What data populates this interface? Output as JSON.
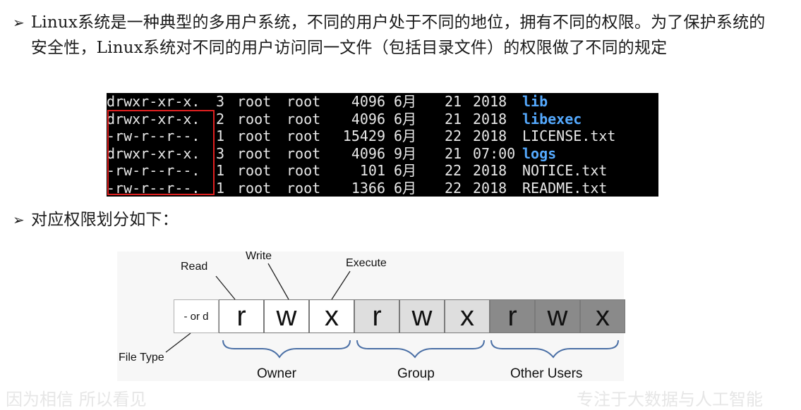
{
  "bullets": [
    {
      "marker": "➢",
      "text": "Linux系统是一种典型的多用户系统，不同的用户处于不同的地位，拥有不同的权限。为了保护系统的安全性，Linux系统对不同的用户访问同一文件（包括目录文件）的权限做了不同的规定"
    },
    {
      "marker": "➢",
      "text": "对应权限划分如下："
    }
  ],
  "terminal": {
    "rows": [
      {
        "perm": "drwxr-xr-x.",
        "links": "3",
        "owner": "root",
        "group": "root",
        "size": "4096",
        "month": "6月",
        "day": "21",
        "time": "2018",
        "name": "lib",
        "is_dir": true
      },
      {
        "perm": "drwxr-xr-x.",
        "links": "2",
        "owner": "root",
        "group": "root",
        "size": "4096",
        "month": "6月",
        "day": "21",
        "time": "2018",
        "name": "libexec",
        "is_dir": true
      },
      {
        "perm": "-rw-r--r--.",
        "links": "1",
        "owner": "root",
        "group": "root",
        "size": "15429",
        "month": "6月",
        "day": "22",
        "time": "2018",
        "name": "LICENSE.txt",
        "is_dir": false
      },
      {
        "perm": "drwxr-xr-x.",
        "links": "3",
        "owner": "root",
        "group": "root",
        "size": "4096",
        "month": "9月",
        "day": "21",
        "time": "07:00",
        "name": "logs",
        "is_dir": true
      },
      {
        "perm": "-rw-r--r--.",
        "links": "1",
        "owner": "root",
        "group": "root",
        "size": "101",
        "month": "6月",
        "day": "22",
        "time": "2018",
        "name": "NOTICE.txt",
        "is_dir": false
      },
      {
        "perm": "-rw-r--r--.",
        "links": "1",
        "owner": "root",
        "group": "root",
        "size": "1366",
        "month": "6月",
        "day": "22",
        "time": "2018",
        "name": "README.txt",
        "is_dir": false
      }
    ],
    "highlight_color": "#e02020",
    "dir_color": "#55aaff"
  },
  "diagram": {
    "type_cell": "- or d",
    "cells": [
      {
        "letter": "r",
        "group": "owner"
      },
      {
        "letter": "w",
        "group": "owner"
      },
      {
        "letter": "x",
        "group": "owner"
      },
      {
        "letter": "r",
        "group": "group"
      },
      {
        "letter": "w",
        "group": "group"
      },
      {
        "letter": "x",
        "group": "group"
      },
      {
        "letter": "r",
        "group": "other"
      },
      {
        "letter": "w",
        "group": "other"
      },
      {
        "letter": "x",
        "group": "other"
      }
    ],
    "labels": {
      "read": "Read",
      "write": "Write",
      "execute": "Execute",
      "file_type": "File Type"
    },
    "groups": {
      "owner": "Owner",
      "group": "Group",
      "other": "Other Users"
    },
    "colors": {
      "owner": "#ffffff",
      "group": "#dedede",
      "other": "#8a8a8a",
      "brace": "#4a6fa5"
    }
  },
  "watermark": {
    "left": "因为相信 所以看见",
    "right": "专注于大数据与人工智能"
  }
}
